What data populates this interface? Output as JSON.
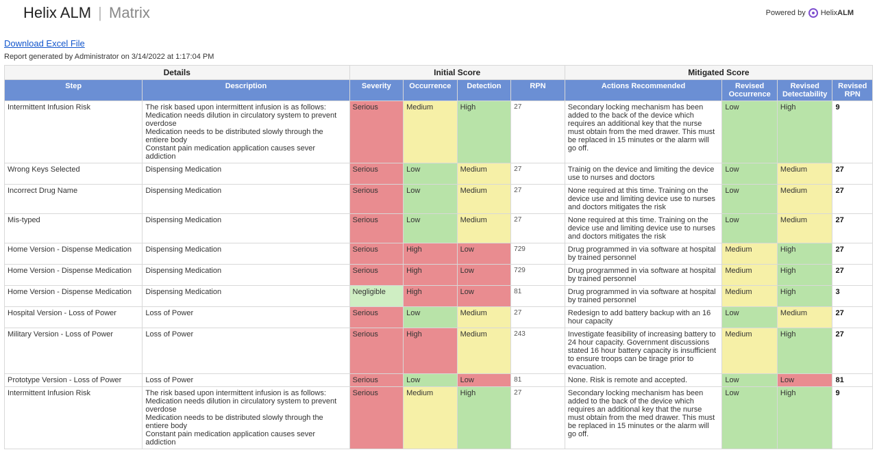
{
  "header": {
    "app_name": "Helix ALM",
    "separator": "|",
    "page_name": "Matrix",
    "powered_by_label": "Powered by",
    "powered_by_brand_a": "Helix",
    "powered_by_brand_b": "ALM"
  },
  "download_link_label": "Download Excel File",
  "meta_line": "Report generated by Administrator on 3/14/2022 at 1:17:04 PM",
  "group_headers": {
    "details": "Details",
    "initial": "Initial Score",
    "mitigated": "Mitigated Score"
  },
  "columns": {
    "step": "Step",
    "description": "Description",
    "severity": "Severity",
    "occurrence": "Occurrence",
    "detection": "Detection",
    "rpn": "RPN",
    "actions": "Actions Recommended",
    "r_occ": "Revised Occurrence",
    "r_det": "Revised Detectability",
    "r_rpn": "Revised RPN"
  },
  "rows": [
    {
      "step": "Intermittent Infusion Risk",
      "description": "The risk based upon intermittent infusion is as follows:\nMedication needs dilution in circulatory system to prevent overdose\nMedication needs to be distributed slowly through the entiere body\nConstant pain medication application causes sever addiction",
      "sev": {
        "text": "Serious",
        "cls": "sev-serious"
      },
      "occ": {
        "text": "Medium",
        "cls": "lvl-medium"
      },
      "det": {
        "text": "High",
        "cls": "lvl-high-g"
      },
      "rpn": "27",
      "actions": "Secondary locking mechanism has been added to the back of the device which requires an additional key that the nurse must obtain from the med drawer.  This must be replaced in 15 minutes or the alarm will go off.",
      "rocc": {
        "text": "Low",
        "cls": "lvl-low"
      },
      "rdet": {
        "text": "High",
        "cls": "lvl-high-g"
      },
      "rrpn": "9"
    },
    {
      "step": "Wrong Keys Selected",
      "description": "Dispensing Medication",
      "sev": {
        "text": "Serious",
        "cls": "sev-serious"
      },
      "occ": {
        "text": "Low",
        "cls": "lvl-low"
      },
      "det": {
        "text": "Medium",
        "cls": "lvl-medium"
      },
      "rpn": "27",
      "actions": "Trainig on the device and limiting the device use to nurses and doctors",
      "rocc": {
        "text": "Low",
        "cls": "lvl-low"
      },
      "rdet": {
        "text": "Medium",
        "cls": "lvl-medium-y"
      },
      "rrpn": "27"
    },
    {
      "step": "Incorrect Drug Name",
      "description": "Dispensing Medication",
      "sev": {
        "text": "Serious",
        "cls": "sev-serious"
      },
      "occ": {
        "text": "Low",
        "cls": "lvl-low"
      },
      "det": {
        "text": "Medium",
        "cls": "lvl-medium"
      },
      "rpn": "27",
      "actions": "None required at this time.  Training on the device use and limiting device use to nurses and doctors mitigates the risk",
      "rocc": {
        "text": "Low",
        "cls": "lvl-low"
      },
      "rdet": {
        "text": "Medium",
        "cls": "lvl-medium-y"
      },
      "rrpn": "27"
    },
    {
      "step": "Mis-typed",
      "description": "Dispensing Medication",
      "sev": {
        "text": "Serious",
        "cls": "sev-serious"
      },
      "occ": {
        "text": "Low",
        "cls": "lvl-low"
      },
      "det": {
        "text": "Medium",
        "cls": "lvl-medium"
      },
      "rpn": "27",
      "actions": "None required at this time.  Training on the device use and limiting device use to nurses and doctors mitigates the risk",
      "rocc": {
        "text": "Low",
        "cls": "lvl-low"
      },
      "rdet": {
        "text": "Medium",
        "cls": "lvl-medium-y"
      },
      "rrpn": "27"
    },
    {
      "step": "Home Version - Dispense Medication",
      "description": "Dispensing Medication",
      "sev": {
        "text": "Serious",
        "cls": "sev-serious"
      },
      "occ": {
        "text": "High",
        "cls": "lvl-high-r"
      },
      "det": {
        "text": "Low",
        "cls": "lvl-low-red"
      },
      "rpn": "729",
      "actions": "Drug programmed in via software at hospital by trained personnel",
      "rocc": {
        "text": "Medium",
        "cls": "lvl-medium-y"
      },
      "rdet": {
        "text": "High",
        "cls": "lvl-high-g"
      },
      "rrpn": "27"
    },
    {
      "step": "Home Version - Dispense Medication",
      "description": "Dispensing Medication",
      "sev": {
        "text": "Serious",
        "cls": "sev-serious"
      },
      "occ": {
        "text": "High",
        "cls": "lvl-high-r"
      },
      "det": {
        "text": "Low",
        "cls": "lvl-low-red"
      },
      "rpn": "729",
      "actions": "Drug programmed in via software at hospital by trained personnel",
      "rocc": {
        "text": "Medium",
        "cls": "lvl-medium-y"
      },
      "rdet": {
        "text": "High",
        "cls": "lvl-high-g"
      },
      "rrpn": "27"
    },
    {
      "step": "Home Version - Dispense Medication",
      "description": "Dispensing Medication",
      "sev": {
        "text": "Negligible",
        "cls": "sev-negligible"
      },
      "occ": {
        "text": "High",
        "cls": "lvl-high-r"
      },
      "det": {
        "text": "Low",
        "cls": "lvl-low-red"
      },
      "rpn": "81",
      "actions": "Drug programmed in via software at hospital by trained personnel",
      "rocc": {
        "text": "Medium",
        "cls": "lvl-medium-y"
      },
      "rdet": {
        "text": "High",
        "cls": "lvl-high-g"
      },
      "rrpn": "3"
    },
    {
      "step": "Hospital Version - Loss of Power",
      "description": "Loss of Power",
      "sev": {
        "text": "Serious",
        "cls": "sev-serious"
      },
      "occ": {
        "text": "Low",
        "cls": "lvl-low"
      },
      "det": {
        "text": "Medium",
        "cls": "lvl-medium"
      },
      "rpn": "27",
      "actions": "Redesign to add battery backup with an 16 hour capacity",
      "rocc": {
        "text": "Low",
        "cls": "lvl-low"
      },
      "rdet": {
        "text": "Medium",
        "cls": "lvl-medium-y"
      },
      "rrpn": "27"
    },
    {
      "step": "Military Version - Loss of Power",
      "description": "Loss of Power",
      "sev": {
        "text": "Serious",
        "cls": "sev-serious"
      },
      "occ": {
        "text": "High",
        "cls": "lvl-high-r"
      },
      "det": {
        "text": "Medium",
        "cls": "lvl-medium"
      },
      "rpn": "243",
      "actions": "Investigate feasibility of increasing battery to 24 hour capacity.  Government discussions stated 16 hour battery capacity is insufficient to ensure troops can be tirage prior to evacuation.",
      "rocc": {
        "text": "Medium",
        "cls": "lvl-medium-y"
      },
      "rdet": {
        "text": "High",
        "cls": "lvl-high-g"
      },
      "rrpn": "27"
    },
    {
      "step": "Prototype Version - Loss of Power",
      "description": "Loss of Power",
      "sev": {
        "text": "Serious",
        "cls": "sev-serious"
      },
      "occ": {
        "text": "Low",
        "cls": "lvl-low"
      },
      "det": {
        "text": "Low",
        "cls": "lvl-low-red"
      },
      "rpn": "81",
      "actions": "None.  Risk is remote and accepted.",
      "rocc": {
        "text": "Low",
        "cls": "lvl-low"
      },
      "rdet": {
        "text": "Low",
        "cls": "lvl-low-red"
      },
      "rrpn": "81"
    },
    {
      "step": "Intermittent Infusion Risk",
      "description": "The risk based upon intermittent infusion is as follows:\nMedication needs dilution in circulatory system to prevent overdose\nMedication needs to be distributed slowly through the entiere body\nConstant pain medication application causes sever addiction",
      "sev": {
        "text": "Serious",
        "cls": "sev-serious"
      },
      "occ": {
        "text": "Medium",
        "cls": "lvl-medium"
      },
      "det": {
        "text": "High",
        "cls": "lvl-high-g"
      },
      "rpn": "27",
      "actions": "Secondary locking mechanism has been added to the back of the device which requires an additional key that the nurse must obtain from the med drawer.  This must be replaced in 15 minutes or the alarm will go off.",
      "rocc": {
        "text": "Low",
        "cls": "lvl-low"
      },
      "rdet": {
        "text": "High",
        "cls": "lvl-high-g"
      },
      "rrpn": "9"
    }
  ]
}
